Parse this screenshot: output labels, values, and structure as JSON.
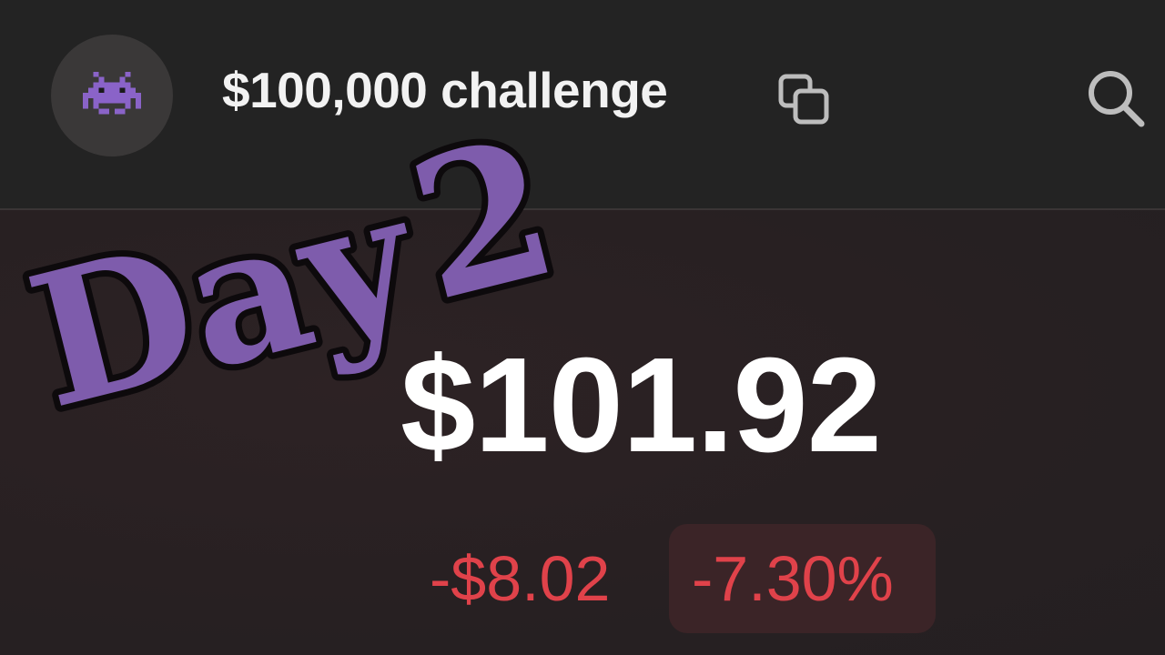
{
  "header": {
    "avatar_icon": "alien-monster-icon",
    "title": "$100,000 challenge",
    "copy_icon": "copy-icon",
    "search_icon": "search-icon"
  },
  "overlay": {
    "day_word": "Day",
    "day_number": "2",
    "color": "#7e5cac"
  },
  "portfolio": {
    "balance": "$101.92",
    "change_amount": "-$8.02",
    "change_percent": "-7.30%",
    "change_color": "#e0424a"
  }
}
